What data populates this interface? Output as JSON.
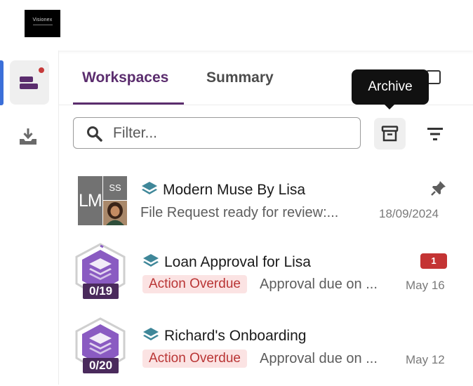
{
  "app": {
    "logo_text": "Visionex"
  },
  "tabs": [
    {
      "label": "Workspaces",
      "active": true
    },
    {
      "label": "Summary",
      "active": false
    }
  ],
  "tooltip": {
    "label": "Archive"
  },
  "filter": {
    "placeholder": "Filter...",
    "value": ""
  },
  "icons": {
    "search": "search-icon",
    "archive": "archive-icon",
    "sort": "sort-icon",
    "window": "window-icon",
    "download": "download-icon",
    "workspace": "workspace-icon",
    "layers": "layers-icon",
    "pin": "pin-icon"
  },
  "colors": {
    "accent": "#5b2d6e",
    "nav_active": "#3b6fd9",
    "notification_dot": "#c63a3a",
    "overdue_bg": "#fbe3e3",
    "overdue_text": "#b93535",
    "badge": "#c43434",
    "layers_icon": "#3f8799",
    "hex_purple": "#8a5bc2"
  },
  "workspaces": [
    {
      "title": "Modern Muse By Lisa",
      "subtitle": "File Request ready for review:...",
      "date": "18/09/2024",
      "avatar_initials_main": "LM",
      "avatar_initials_secondary": "SS",
      "pinned": true
    },
    {
      "title": "Loan Approval for Lisa",
      "status": "Action Overdue",
      "subtitle": "Approval due on ...",
      "date": "May 16",
      "progress": "0/19",
      "unread": "1"
    },
    {
      "title": "Richard's Onboarding",
      "status": "Action Overdue",
      "subtitle": "Approval due on ...",
      "date": "May 12",
      "progress": "0/20"
    }
  ]
}
